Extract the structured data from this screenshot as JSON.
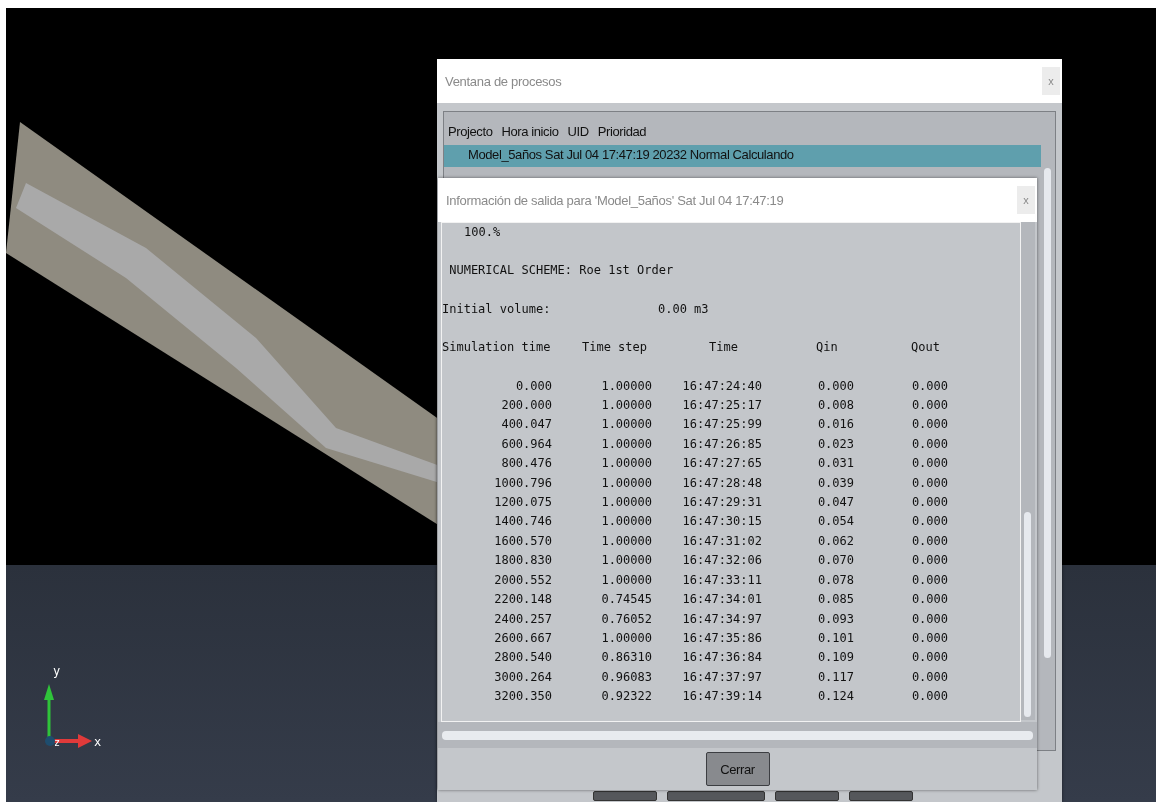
{
  "axes": {
    "y": "y",
    "z": "z",
    "x": "x"
  },
  "process_window": {
    "title": "Ventana de procesos",
    "close": "x",
    "columns": [
      "Projecto",
      "Hora inicio",
      "UID",
      "Prioridad"
    ],
    "rows": [
      {
        "text": "Model_5años Sat Jul 04 17:47:19 20232 Normal Calculando",
        "selected": true
      }
    ]
  },
  "output_dialog": {
    "title": "Información de salida para 'Model_5años' Sat Jul 04 17:47:19",
    "close": "x",
    "lines": [
      "100.%",
      " NUMERICAL SCHEME: Roe 1st Order"
    ],
    "volume_label": "Initial volume:",
    "volume_value": "0.00 m3",
    "columns": [
      "Simulation time",
      "Time step",
      "Time",
      "Qin",
      "Qout"
    ],
    "rows": [
      [
        "0.000",
        "1.00000",
        "16:47:24:40",
        "0.000",
        "0.000"
      ],
      [
        "200.000",
        "1.00000",
        "16:47:25:17",
        "0.008",
        "0.000"
      ],
      [
        "400.047",
        "1.00000",
        "16:47:25:99",
        "0.016",
        "0.000"
      ],
      [
        "600.964",
        "1.00000",
        "16:47:26:85",
        "0.023",
        "0.000"
      ],
      [
        "800.476",
        "1.00000",
        "16:47:27:65",
        "0.031",
        "0.000"
      ],
      [
        "1000.796",
        "1.00000",
        "16:47:28:48",
        "0.039",
        "0.000"
      ],
      [
        "1200.075",
        "1.00000",
        "16:47:29:31",
        "0.047",
        "0.000"
      ],
      [
        "1400.746",
        "1.00000",
        "16:47:30:15",
        "0.054",
        "0.000"
      ],
      [
        "1600.570",
        "1.00000",
        "16:47:31:02",
        "0.062",
        "0.000"
      ],
      [
        "1800.830",
        "1.00000",
        "16:47:32:06",
        "0.070",
        "0.000"
      ],
      [
        "2000.552",
        "1.00000",
        "16:47:33:11",
        "0.078",
        "0.000"
      ],
      [
        "2200.148",
        "0.74545",
        "16:47:34:01",
        "0.085",
        "0.000"
      ],
      [
        "2400.257",
        "0.76052",
        "16:47:34:97",
        "0.093",
        "0.000"
      ],
      [
        "2600.667",
        "1.00000",
        "16:47:35:86",
        "0.101",
        "0.000"
      ],
      [
        "2800.540",
        "0.86310",
        "16:47:36:84",
        "0.109",
        "0.000"
      ],
      [
        "3000.264",
        "0.96083",
        "16:47:37:97",
        "0.117",
        "0.000"
      ],
      [
        "3200.350",
        "0.92322",
        "16:47:39:14",
        "0.124",
        "0.000"
      ]
    ],
    "button": "Cerrar"
  }
}
